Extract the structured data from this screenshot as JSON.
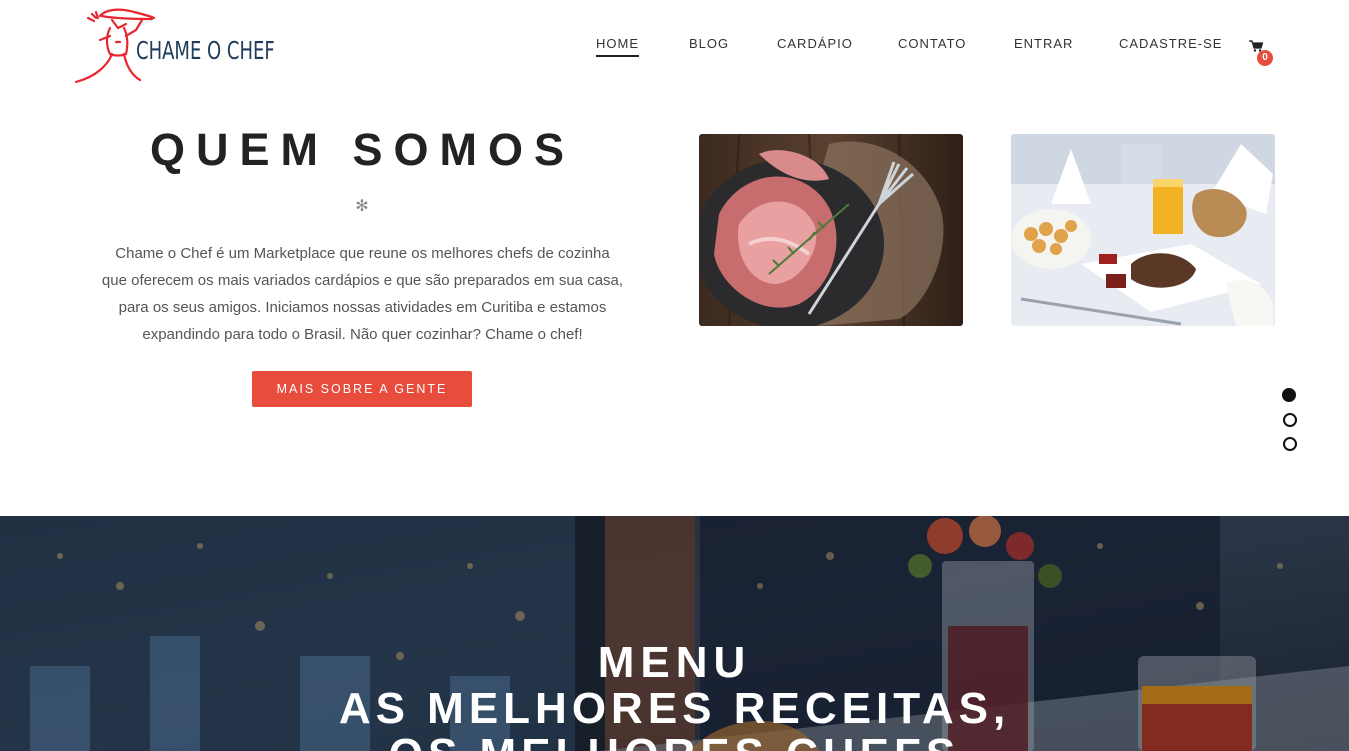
{
  "brand": {
    "name": "CHAME O CHEF",
    "logo_icon": "chef-carrying-tray-icon",
    "logo_color": "#e8262f",
    "text_color": "#1f3c5a"
  },
  "nav": {
    "items": [
      {
        "label": "HOME",
        "active": true
      },
      {
        "label": "BLOG"
      },
      {
        "label": "CARDÁPIO"
      },
      {
        "label": "CONTATO"
      },
      {
        "label": "ENTRAR"
      },
      {
        "label": "CADASTRE-SE"
      }
    ],
    "cart": {
      "icon": "shopping-cart-icon",
      "count": "0"
    }
  },
  "about": {
    "title": "QUEM SOMOS",
    "divider": "✻",
    "text_lines": [
      "Chame o Chef é um Marketplace que reune os melhores chefs de cozinha",
      "que oferecem os mais variados cardápios e que são preparados em sua casa,",
      "para os seus amigos. Iniciamos nossas atividades em Curitiba e estamos",
      "expandindo para todo o Brasil. Não quer cozinhar? Chame o chef!"
    ],
    "button": "MAIS SOBRE A GENTE",
    "images": [
      "cured-ham-with-fork-photo",
      "restaurant-table-dishes-photo"
    ]
  },
  "slider": {
    "dots": 3,
    "active_index": 0
  },
  "menu_banner": {
    "line1": "MENU",
    "line2": "AS MELHORES RECEITAS,",
    "line3": "OS MELHORES CHEFS"
  },
  "colors": {
    "accent": "#e74c3c",
    "heading": "#222222"
  }
}
